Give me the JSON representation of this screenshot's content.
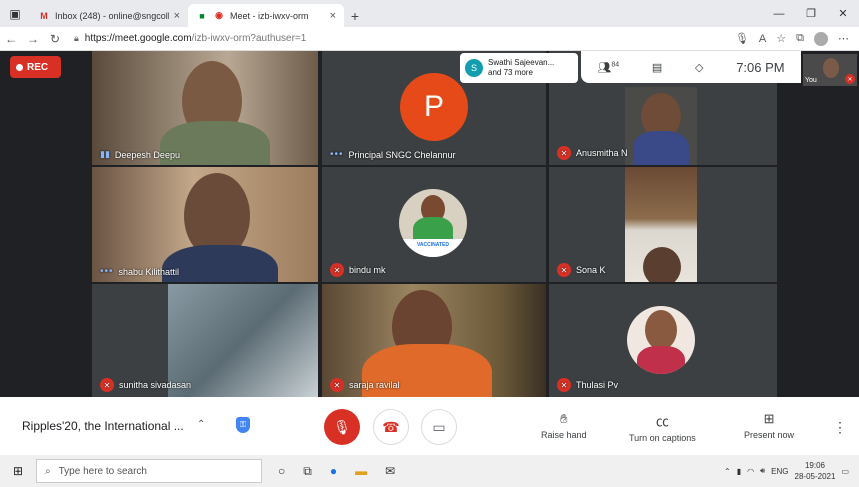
{
  "browser": {
    "tabs": [
      {
        "favicon": "gmail-icon",
        "title": "Inbox (248) - online@sngcolleg"
      },
      {
        "favicon": "meet-icon",
        "title": "Meet - izb-iwxv-orm"
      }
    ],
    "url_host": "https://meet.google.com",
    "url_path": "/izb-iwxv-orm?authuser=1"
  },
  "meet": {
    "rec_label": "REC",
    "popup": {
      "initial": "S",
      "line1": "Swathi Sajeevan...",
      "line2": "and 73 more"
    },
    "people_count": "84",
    "time": "7:06 PM",
    "self_label": "You",
    "participants": [
      {
        "name": "Deepesh Deepu",
        "status": "speaking"
      },
      {
        "name": "Principal SNGC Chelannur",
        "status": "dots",
        "initial": "P"
      },
      {
        "name": "Anusmitha N",
        "status": "muted"
      },
      {
        "name": "shabu Kilithattil",
        "status": "dots"
      },
      {
        "name": "bindu mk",
        "status": "muted",
        "badge": "VACCINATED"
      },
      {
        "name": "Sona K",
        "status": "muted"
      },
      {
        "name": "sunitha sivadasan",
        "status": "muted"
      },
      {
        "name": "saraja ravilal",
        "status": "muted"
      },
      {
        "name": "Thulasi Pv",
        "status": "muted"
      }
    ]
  },
  "controls": {
    "meeting_title": "Ripples'20, the International ...",
    "raise_hand": "Raise hand",
    "captions": "Turn on captions",
    "present": "Present now"
  },
  "taskbar": {
    "search_placeholder": "Type here to search",
    "lang": "ENG",
    "time": "19:06",
    "date": "28-05-2021"
  },
  "colors": {
    "red": "#d93025",
    "meet_bg": "#202124",
    "blue": "#4285f4"
  }
}
